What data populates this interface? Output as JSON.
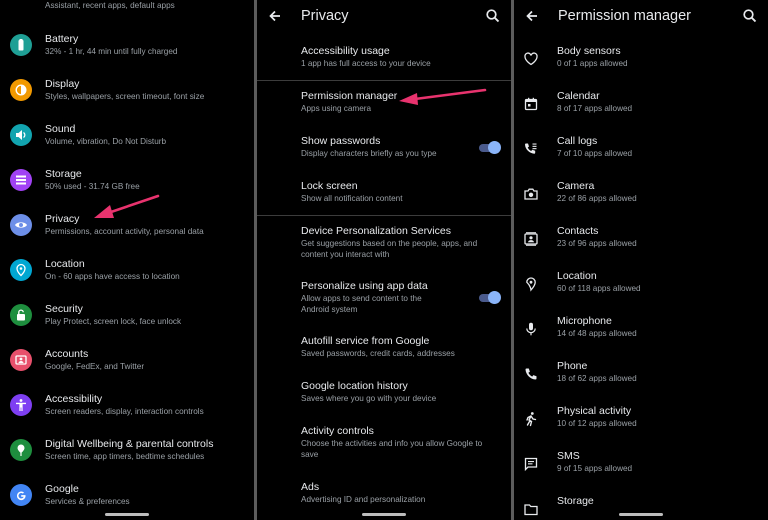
{
  "colors": {
    "battery": "#1f9f95",
    "display": "#f29900",
    "sound": "#12a4af",
    "storage": "#a142f4",
    "privacy": "#6d8fe8",
    "location": "#00a7d2",
    "security": "#1e8e3e",
    "accounts": "#e8506c",
    "accessibility": "#7e3ff2",
    "wellbeing": "#1e8e3e",
    "google": "#4285f4",
    "toggle": "#8ab4f8",
    "annotation_arrow": "#e8336e"
  },
  "settings": {
    "items": [
      {
        "title": "",
        "subtitle": "Assistant, recent apps, default apps",
        "icon": ""
      },
      {
        "title": "Battery",
        "subtitle": "32% - 1 hr, 44 min until fully charged",
        "icon": "battery-icon"
      },
      {
        "title": "Display",
        "subtitle": "Styles, wallpapers, screen timeout, font size",
        "icon": "brightness-icon"
      },
      {
        "title": "Sound",
        "subtitle": "Volume, vibration, Do Not Disturb",
        "icon": "volume-icon"
      },
      {
        "title": "Storage",
        "subtitle": "50% used - 31.74 GB free",
        "icon": "storage-icon"
      },
      {
        "title": "Privacy",
        "subtitle": "Permissions, account activity, personal data",
        "icon": "eye-icon"
      },
      {
        "title": "Location",
        "subtitle": "On - 60 apps have access to location",
        "icon": "location-pin-icon"
      },
      {
        "title": "Security",
        "subtitle": "Play Protect, screen lock, face unlock",
        "icon": "lock-icon"
      },
      {
        "title": "Accounts",
        "subtitle": "Google, FedEx, and Twitter",
        "icon": "account-card-icon"
      },
      {
        "title": "Accessibility",
        "subtitle": "Screen readers, display, interaction controls",
        "icon": "accessibility-icon"
      },
      {
        "title": "Digital Wellbeing & parental controls",
        "subtitle": "Screen time, app timers, bedtime schedules",
        "icon": "wellbeing-icon"
      },
      {
        "title": "Google",
        "subtitle": "Services & preferences",
        "icon": "google-icon"
      }
    ]
  },
  "privacy": {
    "title": "Privacy",
    "items": [
      {
        "title": "Accessibility usage",
        "subtitle": "1 app has full access to your device"
      },
      {
        "title": "Permission manager",
        "subtitle": "Apps using camera"
      },
      {
        "title": "Show passwords",
        "subtitle": "Display characters briefly as you type"
      },
      {
        "title": "Lock screen",
        "subtitle": "Show all notification content"
      },
      {
        "title": "Device Personalization Services",
        "subtitle": "Get suggestions based on the people, apps, and content you interact with"
      },
      {
        "title": "Personalize using app data",
        "subtitle": "Allow apps to send content to the Android system"
      },
      {
        "title": "Autofill service from Google",
        "subtitle": "Saved passwords, credit cards, addresses"
      },
      {
        "title": "Google location history",
        "subtitle": "Saves where you go with your device"
      },
      {
        "title": "Activity controls",
        "subtitle": "Choose the activities and info you allow Google to save"
      },
      {
        "title": "Ads",
        "subtitle": "Advertising ID and personalization"
      }
    ],
    "show_passwords_on": true,
    "personalize_on": true
  },
  "permission_manager": {
    "title": "Permission manager",
    "items": [
      {
        "title": "Body sensors",
        "subtitle": "0 of 1 apps allowed",
        "icon": "heart-icon"
      },
      {
        "title": "Calendar",
        "subtitle": "8 of 17 apps allowed",
        "icon": "calendar-icon"
      },
      {
        "title": "Call logs",
        "subtitle": "7 of 10 apps allowed",
        "icon": "call-log-icon"
      },
      {
        "title": "Camera",
        "subtitle": "22 of 86 apps allowed",
        "icon": "camera-icon"
      },
      {
        "title": "Contacts",
        "subtitle": "23 of 96 apps allowed",
        "icon": "contacts-icon"
      },
      {
        "title": "Location",
        "subtitle": "60 of 118 apps allowed",
        "icon": "location-pin-icon"
      },
      {
        "title": "Microphone",
        "subtitle": "14 of 48 apps allowed",
        "icon": "microphone-icon"
      },
      {
        "title": "Phone",
        "subtitle": "18 of 62 apps allowed",
        "icon": "phone-icon"
      },
      {
        "title": "Physical activity",
        "subtitle": "10 of 12 apps allowed",
        "icon": "walking-icon"
      },
      {
        "title": "SMS",
        "subtitle": "9 of 15 apps allowed",
        "icon": "sms-icon"
      },
      {
        "title": "Storage",
        "subtitle": "",
        "icon": "folder-icon"
      }
    ]
  }
}
